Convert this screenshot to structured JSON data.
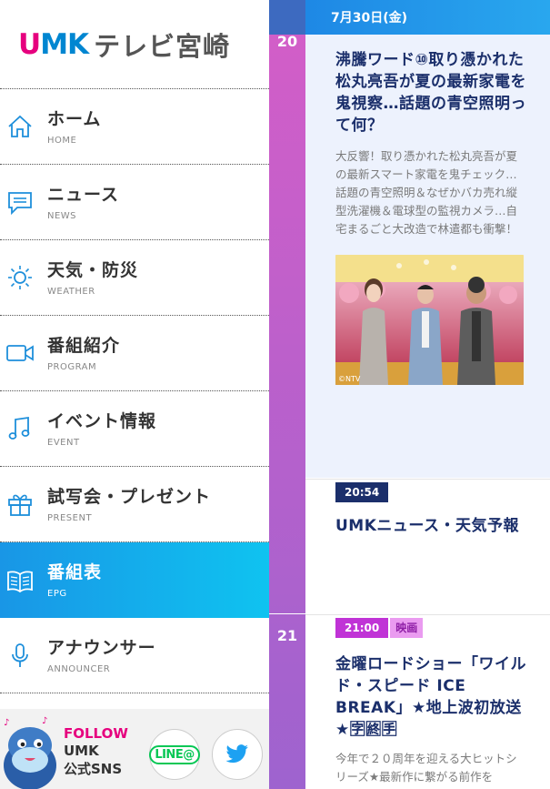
{
  "brand": {
    "umk_u": "U",
    "umk_mk": "MK",
    "jp": "テレビ宮崎"
  },
  "nav": [
    {
      "label": "ホーム",
      "en": "HOME",
      "icon": "home-icon"
    },
    {
      "label": "ニュース",
      "en": "NEWS",
      "icon": "news-icon"
    },
    {
      "label": "天気・防災",
      "en": "WEATHER",
      "icon": "sun-icon"
    },
    {
      "label": "番組紹介",
      "en": "PROGRAM",
      "icon": "video-camera-icon"
    },
    {
      "label": "イベント情報",
      "en": "EVENT",
      "icon": "music-note-icon"
    },
    {
      "label": "試写会・プレゼント",
      "en": "PRESENT",
      "icon": "gift-icon"
    },
    {
      "label": "番組表",
      "en": "EPG",
      "icon": "book-icon",
      "active": true
    },
    {
      "label": "アナウンサー",
      "en": "ANNOUNCER",
      "icon": "microphone-icon"
    }
  ],
  "follow": {
    "line1": "FOLLOW",
    "line2": "UMK",
    "line3": "公式SNS",
    "line_label": "LINE@"
  },
  "epg": {
    "date": "7月30日(金)",
    "hours": [
      "20",
      "21"
    ],
    "programs": [
      {
        "title": "沸騰ワード⑩取り憑かれた松丸亮吾が夏の最新家電を鬼視察…話題の青空照明って何？",
        "desc": "大反響！取り憑かれた松丸亮吾が夏の最新スマート家電を鬼チェック…話題の青空照明＆なぜかバカ売れ縦型洗濯機＆電球型の監視カメラ…自宅まるごと大改造で林遣都も衝撃！",
        "image_credit": "©NTV"
      },
      {
        "time": "20:54",
        "title": "UMKニュース・天気予報"
      },
      {
        "time": "21:00",
        "genre": "映画",
        "title": "金曜ロードショー「ワイルド・スピード ICE BREAK」★地上波初放送★🈑🈡🈐",
        "desc": "今年で２０周年を迎える大ヒットシリーズ★最新作に繋がる前作を"
      }
    ]
  },
  "colors": {
    "active_start": "#1996e6",
    "active_end": "#0fc3f0",
    "timecol": "#c85fc9",
    "title": "#1b2f6b"
  }
}
